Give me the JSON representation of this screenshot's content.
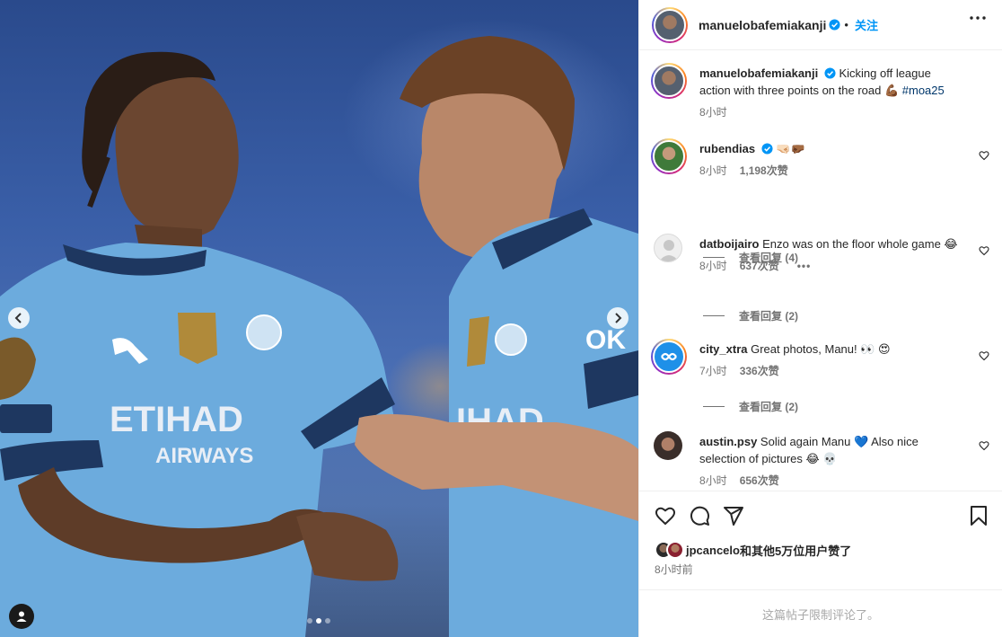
{
  "post": {
    "username": "manuelobafemiakanji",
    "follow_label": "关注",
    "caption_text": "Kicking off league action with three points on the road 💪🏾 ",
    "caption_hashtag": "#moa25",
    "caption_time": "8小时"
  },
  "comments": [
    {
      "user": "rubendias",
      "verified": true,
      "text": "🤜🏻🤛🏾",
      "time": "8小时",
      "likes": "1,198次赞",
      "replies": "查看回复 (4)"
    },
    {
      "user": "datboijairo",
      "verified": false,
      "text": "Enzo was on the floor whole game 😂",
      "time": "8小时",
      "likes": "637次赞",
      "replies": "查看回复 (2)"
    },
    {
      "user": "city_xtra",
      "verified": false,
      "text": "Great photos, Manu! 👀 😍",
      "time": "7小时",
      "likes": "336次赞",
      "replies": "查看回复 (2)"
    },
    {
      "user": "austin.psy",
      "verified": false,
      "text": "Solid again Manu 💙 Also nice selection of pictures 😂 💀",
      "time": "8小时",
      "likes": "656次赞"
    }
  ],
  "liked_by": {
    "user": "jpcancelo",
    "rest": "和其他5万位用户赞了"
  },
  "post_time": "8小时前",
  "comments_limited": "这篇帖子限制评论了。",
  "media": {
    "current_slide": 2,
    "total_slides": 3
  },
  "colors": {
    "accent": "#0095f6",
    "verified": "#0095f6",
    "hashtag": "#00376b",
    "muted": "#737373"
  },
  "icons": [
    "like-icon",
    "comment-icon",
    "share-icon",
    "save-icon",
    "more-options-icon",
    "verified-icon",
    "chevron-left-icon",
    "chevron-right-icon",
    "user-tag-icon"
  ]
}
